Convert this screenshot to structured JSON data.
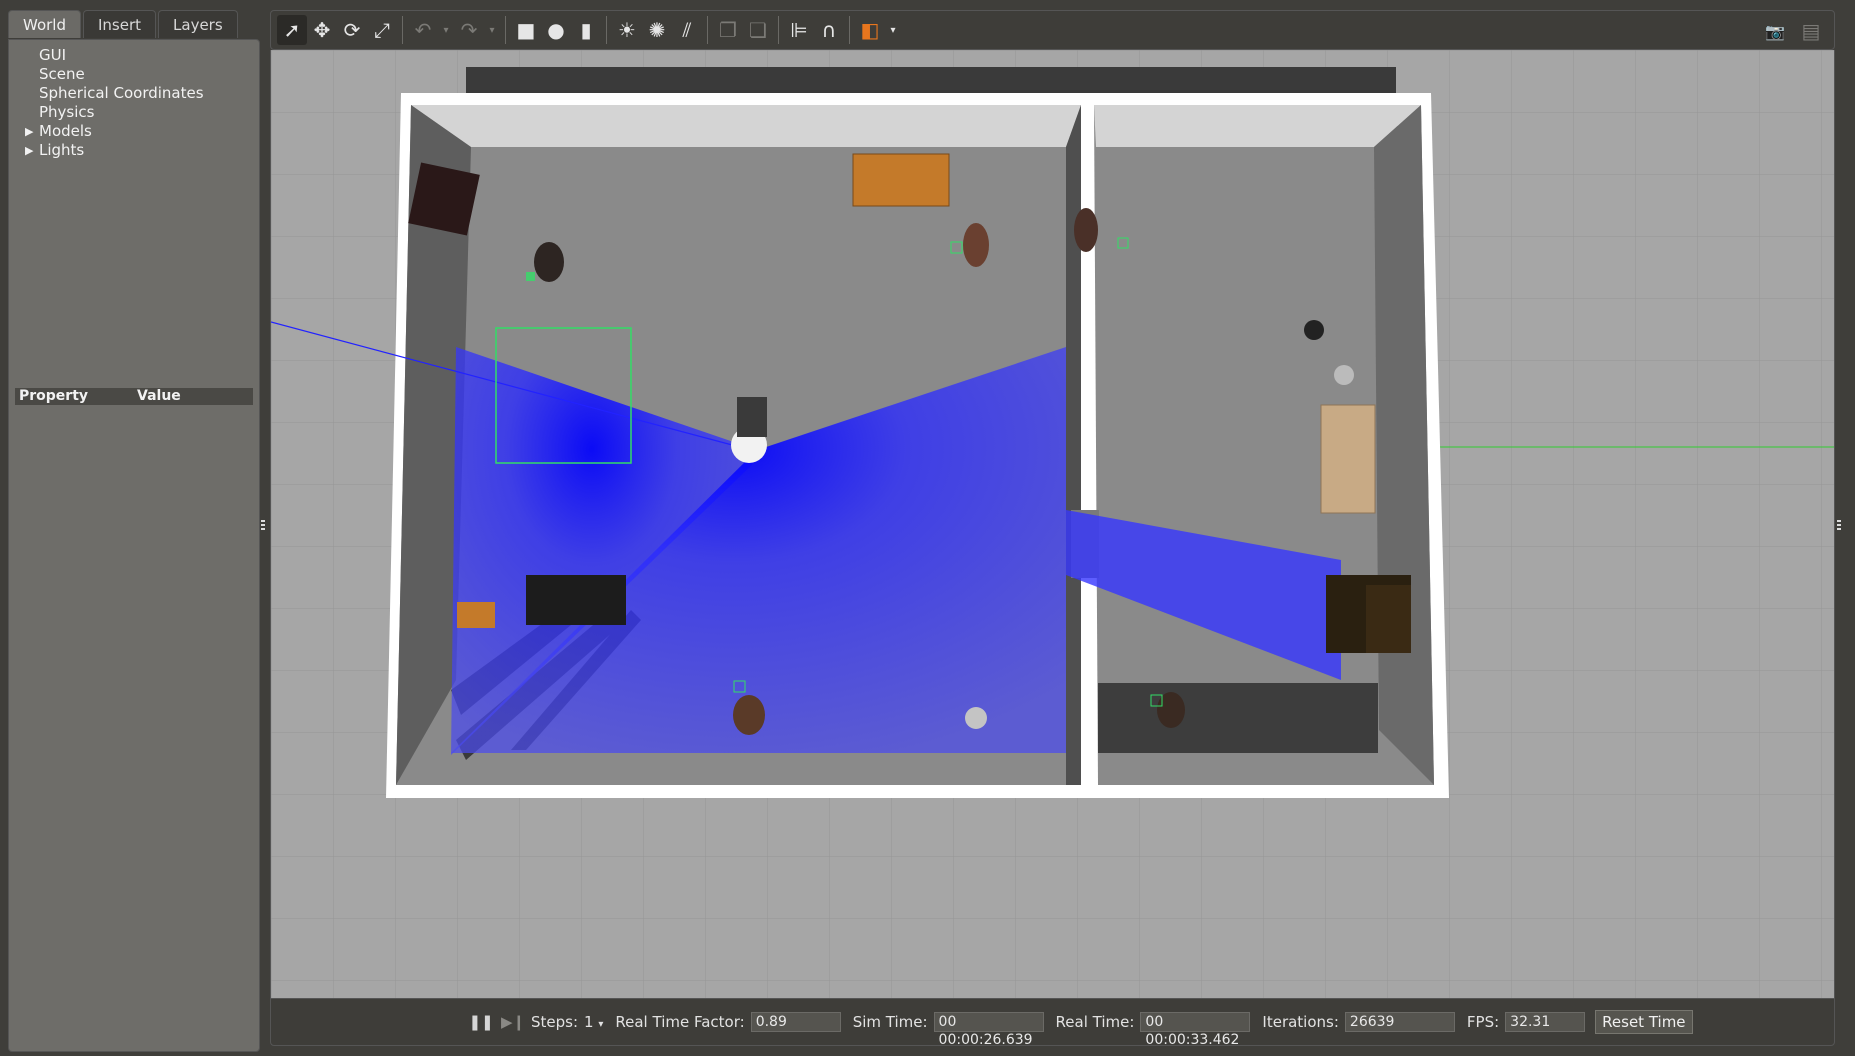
{
  "left_panel": {
    "tabs": [
      {
        "label": "World",
        "active": true
      },
      {
        "label": "Insert",
        "active": false
      },
      {
        "label": "Layers",
        "active": false
      }
    ],
    "tree": [
      {
        "label": "GUI",
        "expandable": false
      },
      {
        "label": "Scene",
        "expandable": false
      },
      {
        "label": "Spherical Coordinates",
        "expandable": false
      },
      {
        "label": "Physics",
        "expandable": false
      },
      {
        "label": "Models",
        "expandable": true
      },
      {
        "label": "Lights",
        "expandable": true
      }
    ],
    "properties": {
      "col_property": "Property",
      "col_value": "Value"
    }
  },
  "toolbar": {
    "tools": [
      {
        "name": "select-mode-icon",
        "glyph": "➚",
        "active": true
      },
      {
        "name": "translate-mode-icon",
        "glyph": "✥",
        "active": false
      },
      {
        "name": "rotate-mode-icon",
        "glyph": "⟳",
        "active": false
      },
      {
        "name": "scale-mode-icon",
        "glyph": "⤢",
        "active": false
      }
    ],
    "history": [
      {
        "name": "undo-icon",
        "glyph": "↶"
      },
      {
        "name": "redo-icon",
        "glyph": "↷"
      }
    ],
    "shapes": [
      {
        "name": "box-icon",
        "glyph": "■"
      },
      {
        "name": "sphere-icon",
        "glyph": "●"
      },
      {
        "name": "cylinder-icon",
        "glyph": "▮"
      }
    ],
    "lights": [
      {
        "name": "point-light-icon",
        "glyph": "☀"
      },
      {
        "name": "spot-light-icon",
        "glyph": "✺"
      },
      {
        "name": "directional-light-icon",
        "glyph": "⫽"
      }
    ],
    "clipboard": [
      {
        "name": "copy-icon",
        "glyph": "❐"
      },
      {
        "name": "paste-icon",
        "glyph": "❏"
      }
    ],
    "align": [
      {
        "name": "align-icon",
        "glyph": "⊫"
      },
      {
        "name": "snap-icon",
        "glyph": "∩"
      }
    ],
    "view_angle_glyph": "◧",
    "right": [
      {
        "name": "screenshot-icon",
        "glyph": "📷"
      },
      {
        "name": "log-icon",
        "glyph": "▤"
      }
    ],
    "accent_color": "#e8761e"
  },
  "bottombar": {
    "steps_label": "Steps:",
    "steps_value": "1",
    "rtf_label": "Real Time Factor:",
    "rtf_value": "0.89",
    "sim_label": "Sim Time:",
    "sim_value": "00 00:00:26.639",
    "real_label": "Real Time:",
    "real_value": "00 00:00:33.462",
    "iter_label": "Iterations:",
    "iter_value": "26639",
    "fps_label": "FPS:",
    "fps_value": "32.31",
    "reset_label": "Reset Time"
  },
  "colors": {
    "laser": "#1e1eff",
    "floor": "#8a8a8a",
    "ground": "#a6a6a6",
    "wall_top": "#ffffff",
    "selection": "#33dd66"
  }
}
